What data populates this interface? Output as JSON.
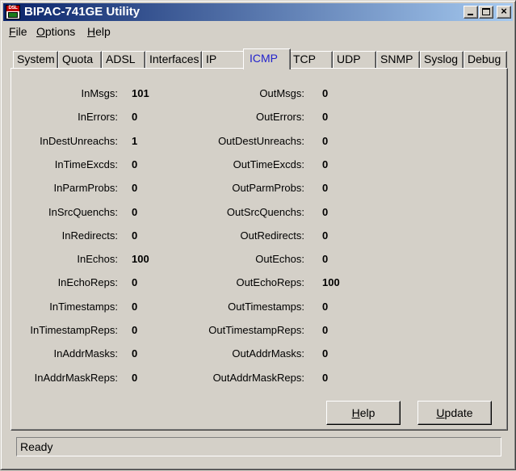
{
  "window": {
    "title": "BIPAC-741GE Utility",
    "icon_label": "DSL",
    "icon": "router-app-icon",
    "controls": {
      "minimize": "minimize-icon",
      "maximize": "maximize-icon",
      "close": "×"
    }
  },
  "menu": {
    "file": {
      "mnemonic": "F",
      "rest": "ile"
    },
    "options": {
      "mnemonic": "O",
      "rest": "ptions"
    },
    "help": {
      "mnemonic": "H",
      "rest": "elp"
    }
  },
  "tabs": [
    "System",
    "Quota",
    "ADSL",
    "Interfaces",
    "IP",
    "ICMP",
    "TCP",
    "UDP",
    "SNMP",
    "Syslog",
    "Debug"
  ],
  "active_tab": "ICMP",
  "stats": {
    "in": [
      {
        "label": "InMsgs:",
        "value": "101"
      },
      {
        "label": "InErrors:",
        "value": "0"
      },
      {
        "label": "InDestUnreachs:",
        "value": "1"
      },
      {
        "label": "InTimeExcds:",
        "value": "0"
      },
      {
        "label": "InParmProbs:",
        "value": "0"
      },
      {
        "label": "InSrcQuenchs:",
        "value": "0"
      },
      {
        "label": "InRedirects:",
        "value": "0"
      },
      {
        "label": "InEchos:",
        "value": "100"
      },
      {
        "label": "InEchoReps:",
        "value": "0"
      },
      {
        "label": "InTimestamps:",
        "value": "0"
      },
      {
        "label": "InTimestampReps:",
        "value": "0"
      },
      {
        "label": "InAddrMasks:",
        "value": "0"
      },
      {
        "label": "InAddrMaskReps:",
        "value": "0"
      }
    ],
    "out": [
      {
        "label": "OutMsgs:",
        "value": "0"
      },
      {
        "label": "OutErrors:",
        "value": "0"
      },
      {
        "label": "OutDestUnreachs:",
        "value": "0"
      },
      {
        "label": "OutTimeExcds:",
        "value": "0"
      },
      {
        "label": "OutParmProbs:",
        "value": "0"
      },
      {
        "label": "OutSrcQuenchs:",
        "value": "0"
      },
      {
        "label": "OutRedirects:",
        "value": "0"
      },
      {
        "label": "OutEchos:",
        "value": "0"
      },
      {
        "label": "OutEchoReps:",
        "value": "100"
      },
      {
        "label": "OutTimestamps:",
        "value": "0"
      },
      {
        "label": "OutTimestampReps:",
        "value": "0"
      },
      {
        "label": "OutAddrMasks:",
        "value": "0"
      },
      {
        "label": "OutAddrMaskReps:",
        "value": "0"
      }
    ]
  },
  "buttons": {
    "help": {
      "mnemonic": "H",
      "rest": "elp"
    },
    "update": {
      "mnemonic": "U",
      "rest": "pdate"
    }
  },
  "status": "Ready",
  "colors": {
    "title_gradient_start": "#0a246a",
    "title_gradient_end": "#a6caf0",
    "active_tab_text": "#2222cc",
    "face": "#d4d0c8"
  }
}
